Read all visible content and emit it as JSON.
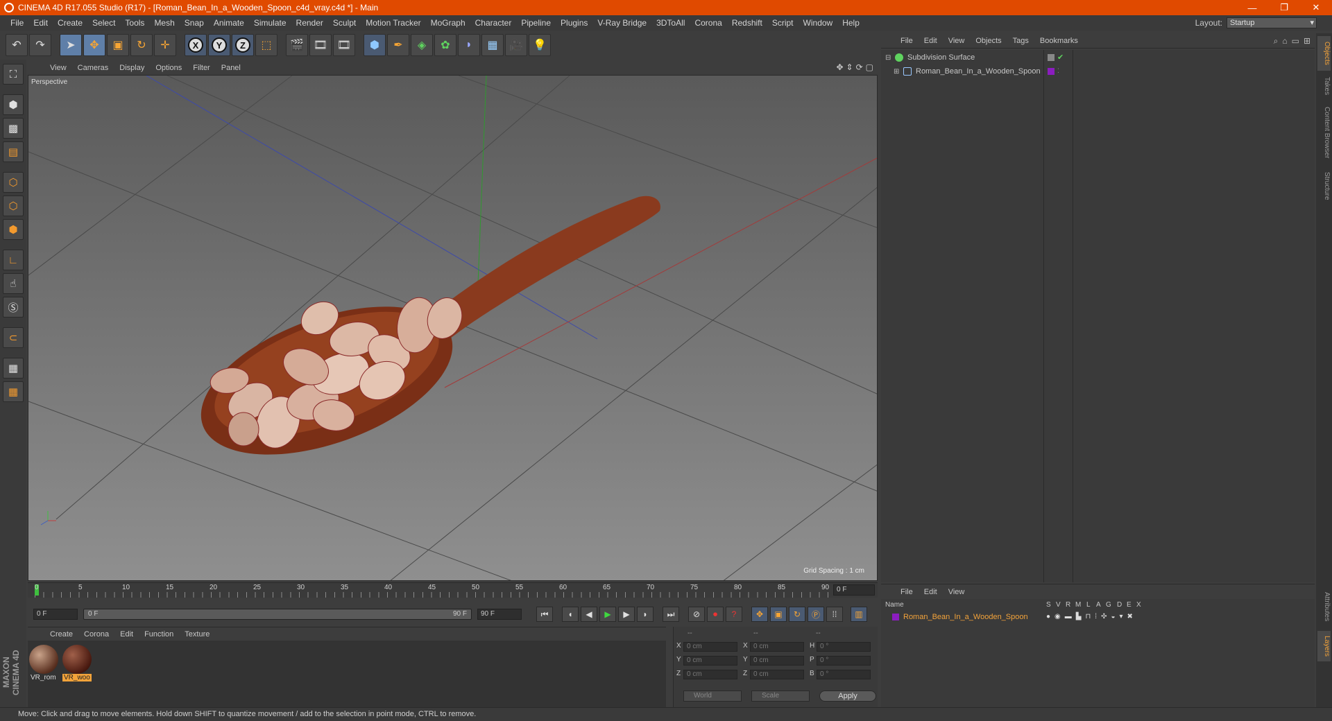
{
  "window": {
    "title": "CINEMA 4D R17.055 Studio (R17) - [Roman_Bean_In_a_Wooden_Spoon_c4d_vray.c4d *] - Main",
    "minimize": "—",
    "restore": "❐",
    "close": "✕"
  },
  "menubar": {
    "items": [
      "File",
      "Edit",
      "Create",
      "Select",
      "Tools",
      "Mesh",
      "Snap",
      "Animate",
      "Simulate",
      "Render",
      "Sculpt",
      "Motion Tracker",
      "MoGraph",
      "Character",
      "Pipeline",
      "Plugins",
      "V-Ray Bridge",
      "3DToAll",
      "Corona",
      "Redshift",
      "Script",
      "Window",
      "Help"
    ],
    "layout_label": "Layout:",
    "layout_value": "Startup"
  },
  "toolbar": {
    "undo": "↶",
    "redo": "↷",
    "axis_x": "X",
    "axis_y": "Y",
    "axis_z": "Z"
  },
  "viewport": {
    "menu": [
      "View",
      "Cameras",
      "Display",
      "Options",
      "Filter",
      "Panel"
    ],
    "camera_label": "Perspective",
    "grid_spacing": "Grid Spacing : 1 cm"
  },
  "timeline": {
    "ticks": [
      "0",
      "5",
      "10",
      "15",
      "20",
      "25",
      "30",
      "35",
      "40",
      "45",
      "50",
      "55",
      "60",
      "65",
      "70",
      "75",
      "80",
      "85",
      "90"
    ],
    "current_frame": "0 F",
    "start_field": "0 F",
    "range_start": "0 F",
    "range_end": "90 F",
    "end_field": "90 F"
  },
  "material_manager": {
    "menu": [
      "Create",
      "Corona",
      "Edit",
      "Function",
      "Texture"
    ],
    "materials": [
      {
        "label": "VR_rom"
      },
      {
        "label": "VR_woo"
      }
    ]
  },
  "coordinates": {
    "headers": [
      "--",
      "--",
      "--"
    ],
    "rows": [
      {
        "pos_label": "X",
        "pos": "0 cm",
        "size_label": "X",
        "size": "0 cm",
        "rot_label": "H",
        "rot": "0 °"
      },
      {
        "pos_label": "Y",
        "pos": "0 cm",
        "size_label": "Y",
        "size": "0 cm",
        "rot_label": "P",
        "rot": "0 °"
      },
      {
        "pos_label": "Z",
        "pos": "0 cm",
        "size_label": "Z",
        "size": "0 cm",
        "rot_label": "B",
        "rot": "0 °"
      }
    ],
    "coord_system": "World",
    "mode": "Scale",
    "apply": "Apply"
  },
  "object_manager": {
    "menu": [
      "File",
      "Edit",
      "View",
      "Objects",
      "Tags",
      "Bookmarks"
    ],
    "objects": [
      {
        "name": "Subdivision Surface"
      },
      {
        "name": "Roman_Bean_In_a_Wooden_Spoon"
      }
    ]
  },
  "layer_manager": {
    "menu": [
      "File",
      "Edit",
      "View"
    ],
    "columns": [
      "Name",
      "S",
      "V",
      "R",
      "M",
      "L",
      "A",
      "G",
      "D",
      "E",
      "X"
    ],
    "layer_name": "Roman_Bean_In_a_Wooden_Spoon"
  },
  "side_tabs": [
    "Objects",
    "Takes",
    "Content Browser",
    "Structure",
    "Attributes",
    "Layers"
  ],
  "status": "Move: Click and drag to move elements. Hold down SHIFT to quantize movement / add to the selection in point mode, CTRL to remove.",
  "colors": {
    "title_bar": "#e04a00",
    "selected_text": "#f3a33a",
    "layer_color": "#8b1dbf",
    "object_green": "#5fd35f"
  }
}
